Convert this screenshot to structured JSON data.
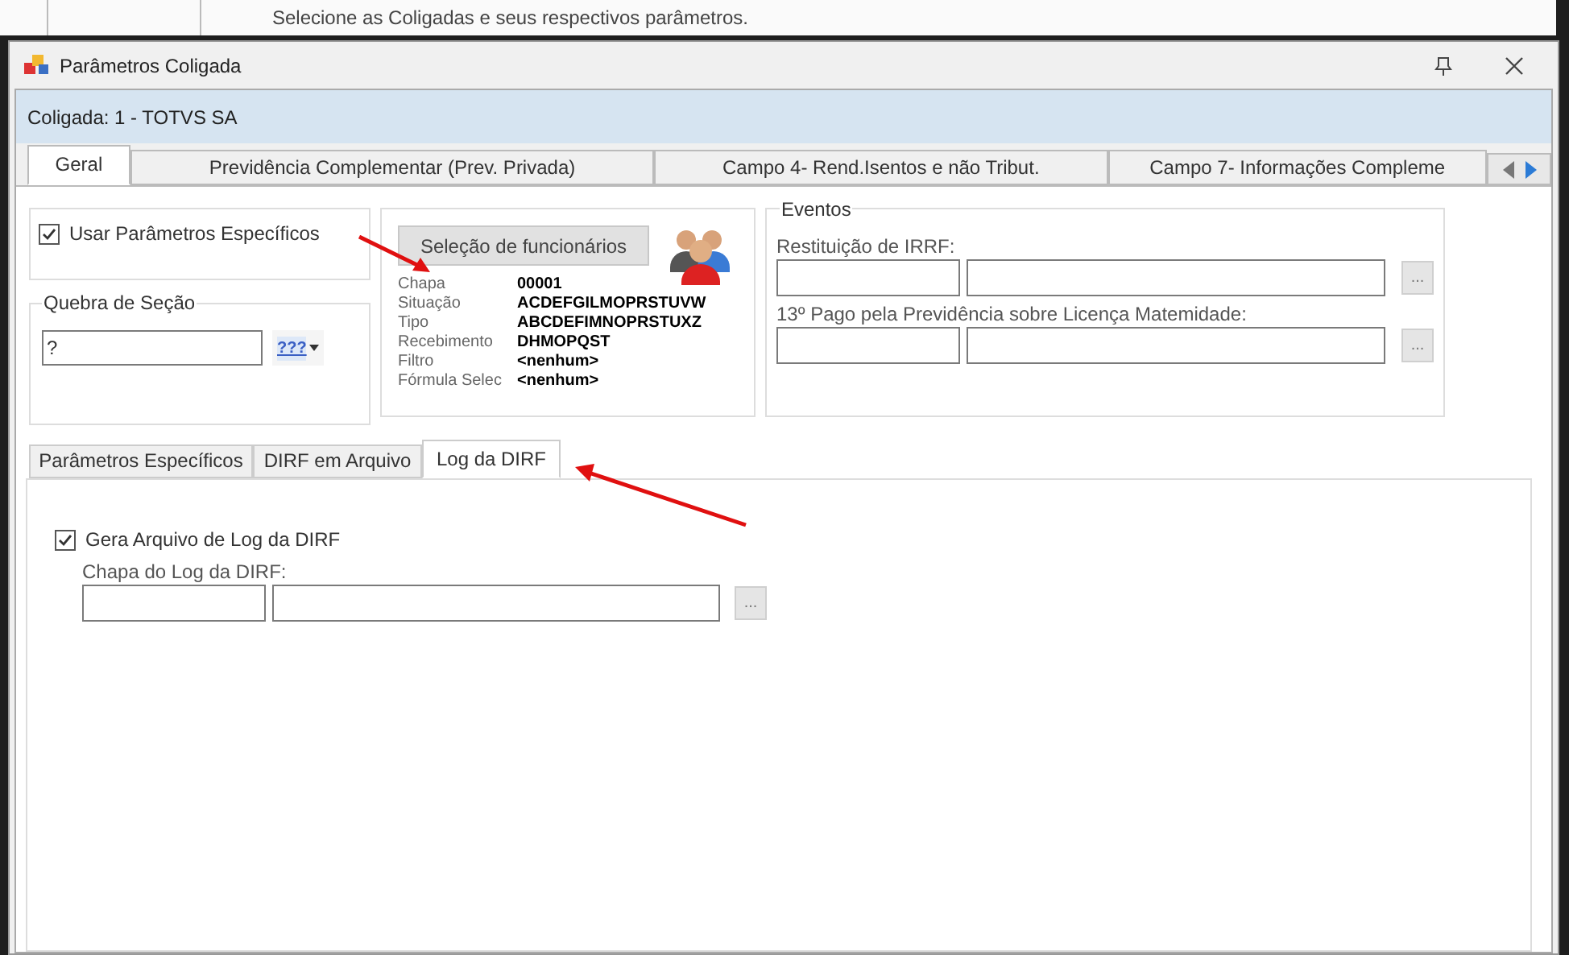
{
  "background_hint": "Selecione as Coligadas e seus respectivos parâmetros.",
  "window": {
    "title": "Parâmetros Coligada"
  },
  "header": "Coligada: 1 - TOTVS SA",
  "tabs": [
    {
      "label": "Geral",
      "selected": true
    },
    {
      "label": "Previdência Complementar (Prev. Privada)",
      "selected": false
    },
    {
      "label": "Campo 4- Rend.Isentos e não Tribut.",
      "selected": false
    },
    {
      "label": "Campo 7- Informações Compleme",
      "selected": false
    }
  ],
  "usar_parametros": {
    "label": "Usar Parâmetros Específicos",
    "checked": true
  },
  "quebra_de_secao": {
    "title": "Quebra de Seção",
    "value": "?",
    "selector": "???"
  },
  "selecao": {
    "button": "Seleção de funcionários",
    "rows": [
      {
        "label": "Chapa",
        "value": "00001"
      },
      {
        "label": "Situação",
        "value": "ACDEFGILMOPRSTUVW"
      },
      {
        "label": "Tipo",
        "value": "ABCDEFIMNOPRSTUXZ"
      },
      {
        "label": "Recebimento",
        "value": "DHMOPQST"
      },
      {
        "label": "Filtro",
        "value": "<nenhum>"
      },
      {
        "label": "Fórmula Selec",
        "value": "<nenhum>"
      }
    ]
  },
  "eventos": {
    "title": "Eventos",
    "fields": [
      {
        "label": "Restituição de IRRF:",
        "button": "..."
      },
      {
        "label": "13º Pago pela Previdência sobre Licença Matemidade:",
        "button": "..."
      }
    ]
  },
  "sub_tabs": [
    {
      "label": "Parâmetros Específicos",
      "selected": false
    },
    {
      "label": "DIRF em Arquivo",
      "selected": false
    },
    {
      "label": "Log da DIRF",
      "selected": true
    }
  ],
  "log": {
    "checkbox": {
      "label": "Gera Arquivo de Log da DIRF",
      "checked": true
    },
    "field_label": "Chapa do Log da DIRF:",
    "button": "..."
  }
}
